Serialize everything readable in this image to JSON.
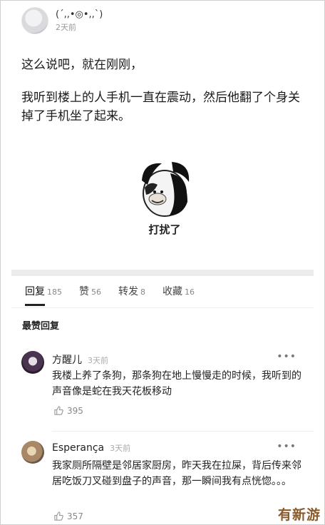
{
  "post": {
    "author": "(´,,•◎•,,`)",
    "time": "2天前",
    "paragraph1": "这么说吧，就在刚刚，",
    "paragraph2": "我听到楼上的人手机一直在震动，然后他翻了个身关掉了手机坐了起来。",
    "meme_caption": "打扰了"
  },
  "tabs": [
    {
      "label": "回复",
      "count": "185"
    },
    {
      "label": "赞",
      "count": "56"
    },
    {
      "label": "转发",
      "count": "8"
    },
    {
      "label": "收藏",
      "count": "16"
    }
  ],
  "section_title": "最赞回复",
  "comments": [
    {
      "name": "方醒儿",
      "time": "3天前",
      "text": "我楼上养了条狗，那条狗在地上慢慢走的时候，我听到的声音像是蛇在我天花板移动",
      "likes": "395"
    },
    {
      "name": "Esperança",
      "time": "3天前",
      "text": "我家厕所隔壁是邻居家厨房，昨天我在拉屎，背后传来邻居吃饭刀叉碰到盘子的声音，那一瞬间我有点恍惚。。。",
      "likes": "357"
    }
  ],
  "more_glyph": "•••",
  "watermark": "有新游"
}
